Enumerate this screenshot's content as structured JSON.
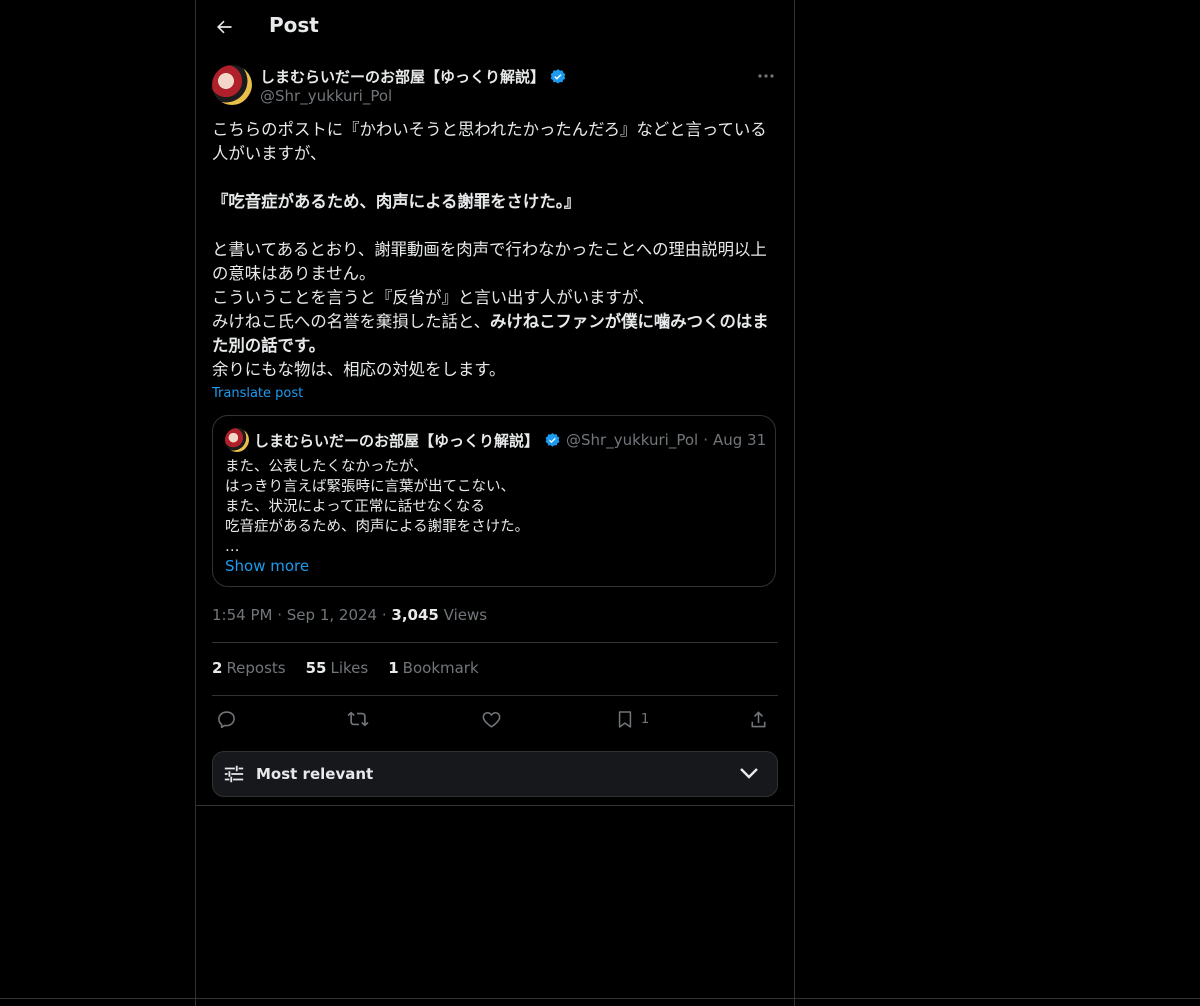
{
  "header": {
    "title": "Post",
    "back_icon": "arrow-left-icon"
  },
  "post": {
    "author_name": "しまむらいだーのお部屋【ゆっくり解説】",
    "author_handle": "@Shr_yukkuri_Pol",
    "verified": true,
    "body_lines": {
      "l1": "こちらのポストに『かわいそうと思われたかったんだろ』などと言っている人がいますが、",
      "l2": "『吃音症があるため、肉声による謝罪をさけた。』",
      "l3": "と書いてあるとおり、謝罪動画を肉声で行わなかったことへの理由説明以上の意味はありません。\nこういうことを言うと『反省が』と言い出す人がいますが、\nみけねこ氏への名誉を棄損した話と、",
      "l4": "みけねこファンが僕に噛みつくのはまた別の話です。",
      "l5": "\n余りにもな物は、相応の対処をします。"
    },
    "translate_label": "Translate post",
    "time": "1:54 PM",
    "date": "Sep 1, 2024",
    "views_count": "3,045",
    "views_label": "Views"
  },
  "quote": {
    "author_name": "しまむらいだーのお部屋【ゆっくり解説】",
    "author_handle": "@Shr_yukkuri_Pol",
    "date": "Aug 31",
    "text": "また、公表したくなかったが、\nはっきり言えば緊張時に言葉が出てこない、\nまた、状況によって正常に話せなくなる\n吃音症があるため、肉声による謝罪をさけた。\n…",
    "show_more": "Show more"
  },
  "stats": {
    "reposts_count": "2",
    "reposts_label": "Reposts",
    "likes_count": "55",
    "likes_label": "Likes",
    "bookmarks_count": "1",
    "bookmarks_label": "Bookmark"
  },
  "actions": {
    "reply_icon": "reply-icon",
    "repost_icon": "repost-icon",
    "like_icon": "heart-icon",
    "bookmark_icon": "bookmark-icon",
    "bookmark_count": "1",
    "share_icon": "share-icon"
  },
  "sort": {
    "label": "Most relevant",
    "icon": "sliders-icon"
  },
  "colors": {
    "background": "#000000",
    "text": "#e7e9ea",
    "muted": "#71767b",
    "accent": "#1d9bf0",
    "border": "#2f3336"
  }
}
